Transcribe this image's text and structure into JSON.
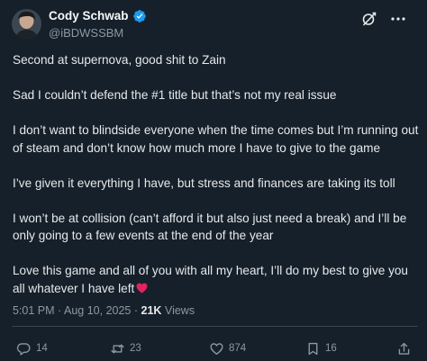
{
  "author": {
    "display_name": "Cody Schwab",
    "handle": "@iBDWSSBM",
    "verified": true
  },
  "post": {
    "paragraphs": [
      "Second at supernova, good shit to Zain",
      "Sad I couldn’t defend the #1 title but that’s not my real issue",
      "I don’t want to blindside everyone when the time comes but I’m running out of steam and don’t know how much more I have to give to the game",
      "I’ve given it everything I have, but stress and finances are taking its toll",
      "I won’t be at collision (can’t afford it but also just need a break) and I’ll be only going to a few events at the end of the year",
      "Love this game and all of you with all my heart, I’ll do my best to give you all whatever I have left"
    ],
    "time": "5:01 PM",
    "separator": "·",
    "date": "Aug 10, 2025",
    "views_count": "21K",
    "views_label": "Views"
  },
  "actions": {
    "replies": "14",
    "reposts": "23",
    "likes": "874",
    "bookmarks": "16"
  },
  "icons": {
    "verified": "verified-badge-icon",
    "grok": "grok-icon",
    "more": "more-icon",
    "heart_emoji": "red-heart-icon",
    "reply": "reply-icon",
    "repost": "repost-icon",
    "like": "heart-icon",
    "bookmark": "bookmark-icon",
    "share": "share-icon"
  },
  "colors": {
    "background": "#15202b",
    "verified": "#1d9bf0",
    "secondary_text": "#8b98a5",
    "heart_emoji": "#e0245e"
  }
}
